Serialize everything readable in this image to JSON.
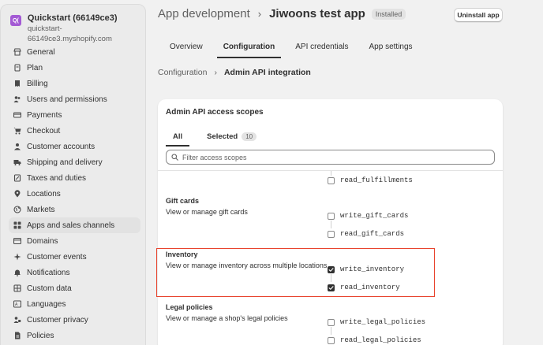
{
  "store": {
    "avatar": "Q(",
    "name": "Quickstart (66149ce3)",
    "domain": "quickstart-66149ce3.myshopify.com"
  },
  "nav": [
    {
      "label": "General",
      "icon": "store-icon"
    },
    {
      "label": "Plan",
      "icon": "plan-icon"
    },
    {
      "label": "Billing",
      "icon": "receipt-icon"
    },
    {
      "label": "Users and permissions",
      "icon": "users-icon"
    },
    {
      "label": "Payments",
      "icon": "card-icon"
    },
    {
      "label": "Checkout",
      "icon": "cart-icon"
    },
    {
      "label": "Customer accounts",
      "icon": "person-icon"
    },
    {
      "label": "Shipping and delivery",
      "icon": "truck-icon"
    },
    {
      "label": "Taxes and duties",
      "icon": "tax-icon"
    },
    {
      "label": "Locations",
      "icon": "location-icon"
    },
    {
      "label": "Markets",
      "icon": "globe-icon"
    },
    {
      "label": "Apps and sales channels",
      "icon": "apps-icon",
      "active": true
    },
    {
      "label": "Domains",
      "icon": "domain-icon"
    },
    {
      "label": "Customer events",
      "icon": "events-icon"
    },
    {
      "label": "Notifications",
      "icon": "bell-icon"
    },
    {
      "label": "Custom data",
      "icon": "data-icon"
    },
    {
      "label": "Languages",
      "icon": "language-icon"
    },
    {
      "label": "Customer privacy",
      "icon": "privacy-icon"
    },
    {
      "label": "Policies",
      "icon": "policy-icon"
    }
  ],
  "header": {
    "parent": "App development",
    "separator": "›",
    "app_name": "Jiwoons test app",
    "badge": "Installed",
    "uninstall_label": "Uninstall app"
  },
  "tabs": [
    "Overview",
    "Configuration",
    "API credentials",
    "App settings"
  ],
  "sub_breadcrumb": {
    "parent": "Configuration",
    "separator": "›",
    "current": "Admin API integration"
  },
  "card": {
    "title": "Admin API access scopes",
    "tab_all": "All",
    "tab_selected": "Selected",
    "selected_count": "10",
    "search_placeholder": "Filter access scopes"
  },
  "sections": {
    "fulfillments": {
      "scope_read": "read_fulfillments"
    },
    "gift_cards": {
      "title": "Gift cards",
      "desc": "View or manage gift cards",
      "scope_write": "write_gift_cards",
      "scope_read": "read_gift_cards"
    },
    "inventory": {
      "title": "Inventory",
      "desc": "View or manage inventory across multiple locations",
      "scope_write": "write_inventory",
      "scope_read": "read_inventory"
    },
    "legal": {
      "title": "Legal policies",
      "desc": "View or manage a shop's legal policies",
      "scope_write": "write_legal_policies",
      "scope_read": "read_legal_policies"
    }
  },
  "colors": {
    "highlight": "#e8442e",
    "avatar": "#a35ad4"
  }
}
